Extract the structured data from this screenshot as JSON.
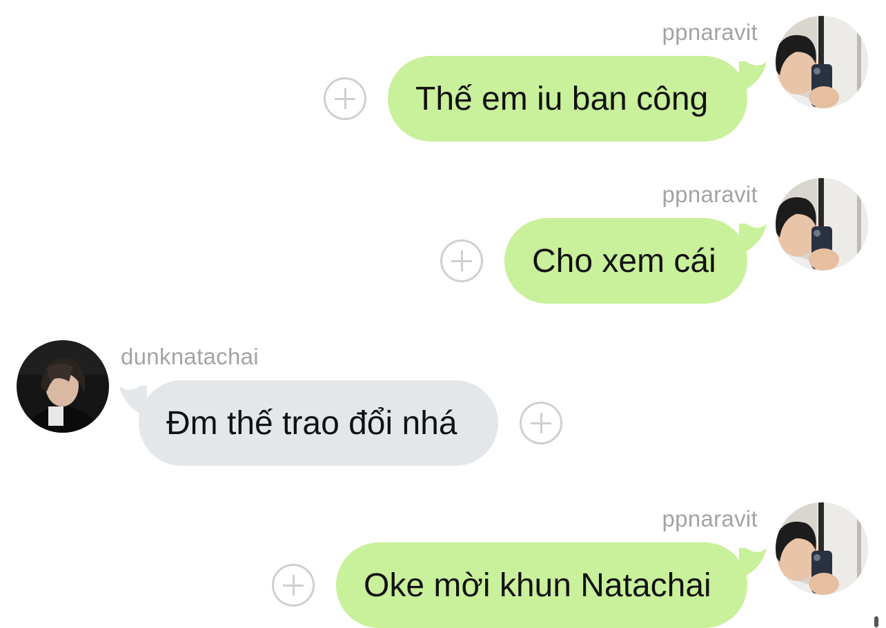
{
  "messages": [
    {
      "sender": "ppnaravit",
      "text": "Thế em iu ban công",
      "direction": "outgoing",
      "avatar": "ppnaravit-avatar"
    },
    {
      "sender": "ppnaravit",
      "text": "Cho xem cái",
      "direction": "outgoing",
      "avatar": "ppnaravit-avatar"
    },
    {
      "sender": "dunknatachai",
      "text": "Đm thế trao đổi nhá",
      "direction": "incoming",
      "avatar": "dunknatachai-avatar"
    },
    {
      "sender": "ppnaravit",
      "text": "Oke mời khun Natachai",
      "direction": "outgoing",
      "avatar": "ppnaravit-avatar"
    }
  ],
  "colors": {
    "outgoing_bubble": "#c9f09a",
    "incoming_bubble": "#e4e7ea",
    "sender_name": "#a3a3a3",
    "add_icon": "#cfcfcf"
  },
  "icons": {
    "add_reaction": "plus-circle-icon"
  }
}
